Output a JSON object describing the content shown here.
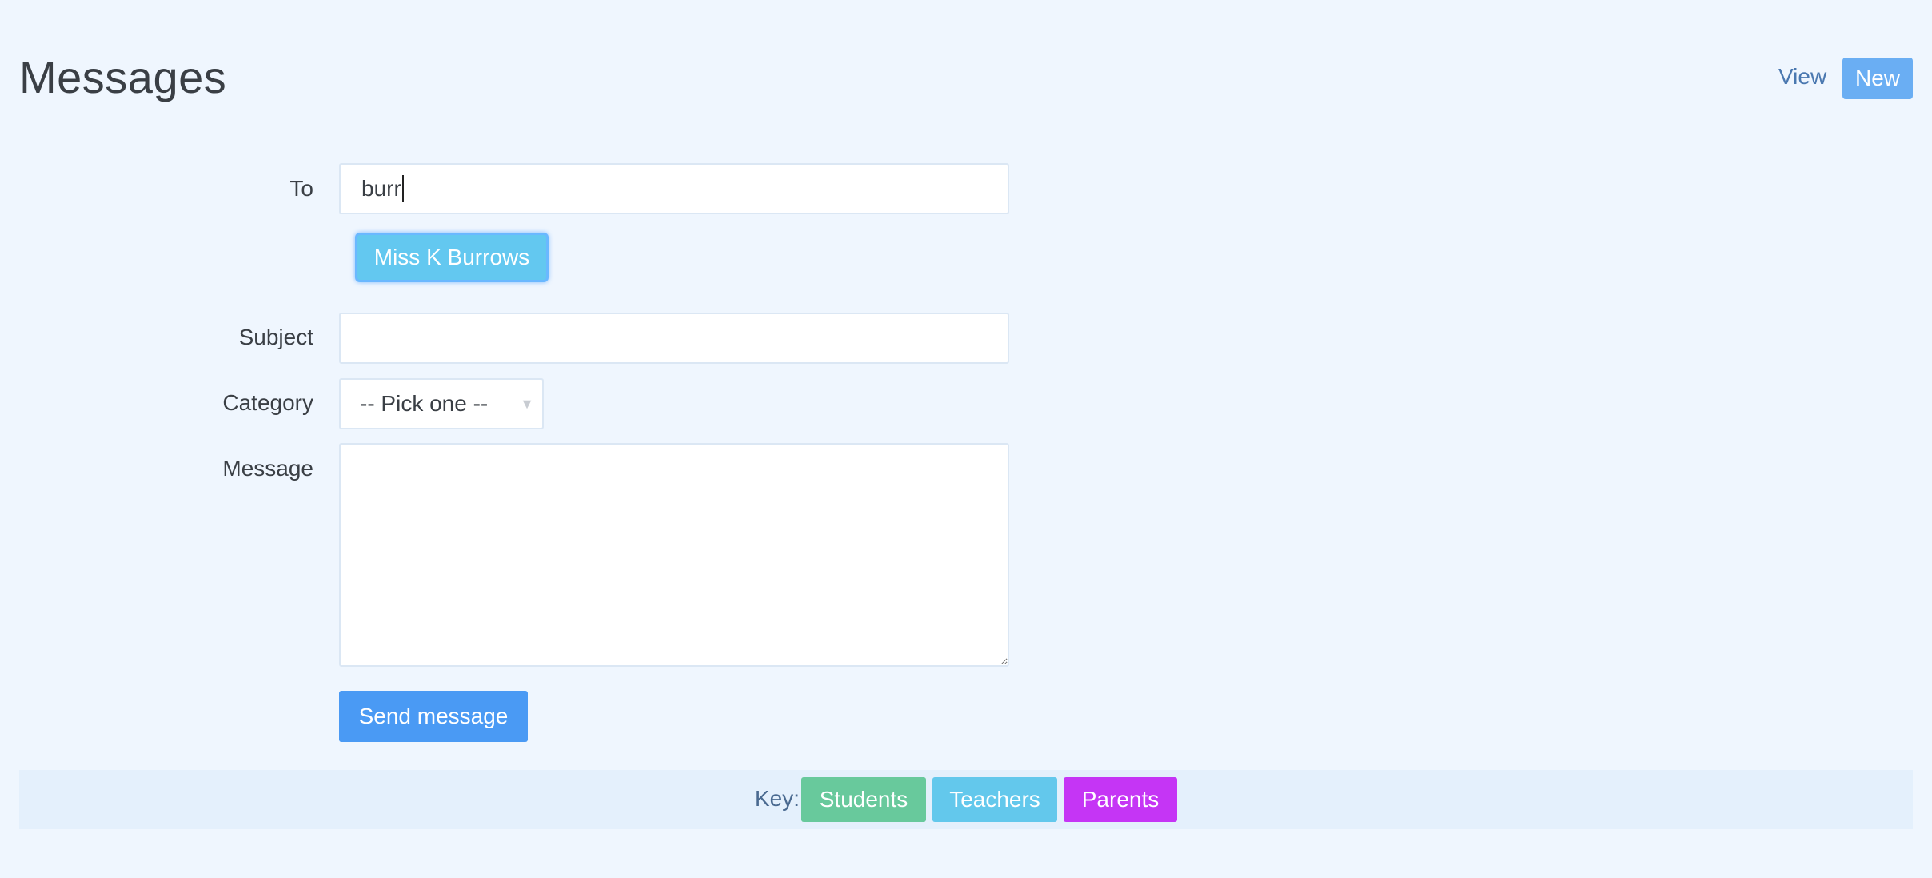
{
  "header": {
    "title": "Messages",
    "view_label": "View",
    "new_label": "New"
  },
  "form": {
    "to_label": "To",
    "to_value": "burr",
    "suggestion": "Miss K Burrows",
    "subject_label": "Subject",
    "subject_value": "",
    "category_label": "Category",
    "category_selected": "-- Pick one --",
    "message_label": "Message",
    "message_value": "",
    "send_label": "Send message"
  },
  "key": {
    "label": "Key:",
    "items": [
      {
        "label": "Students",
        "color": "#68c99c"
      },
      {
        "label": "Teachers",
        "color": "#63c8ec"
      },
      {
        "label": "Parents",
        "color": "#c535f5"
      }
    ]
  },
  "colors": {
    "background": "#eff6fe",
    "primary": "#4a9af4",
    "new_button": "#6aaef3",
    "suggestion": "#63c8f0"
  },
  "icons": {
    "select_arrow": "chevron-down-icon"
  }
}
